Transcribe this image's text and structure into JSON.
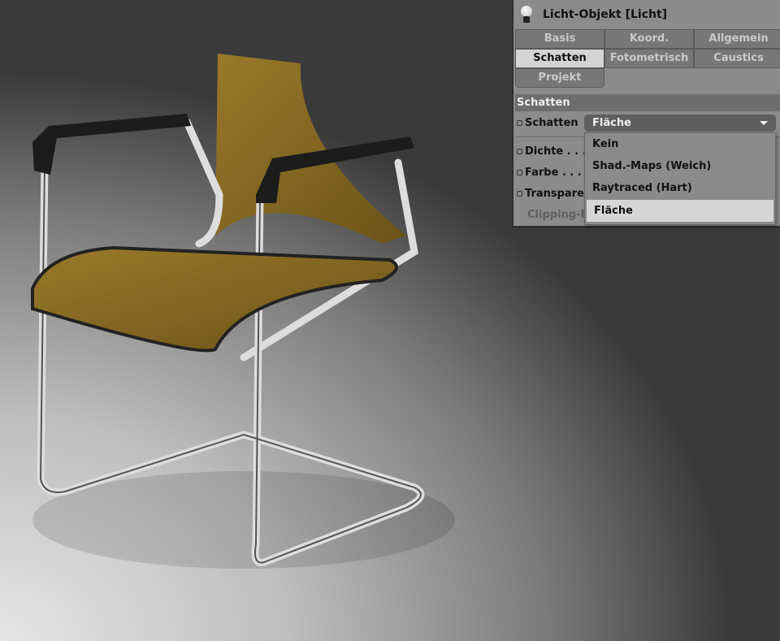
{
  "panel": {
    "title": "Licht-Objekt [Licht]",
    "tabs": [
      "Basis",
      "Koord.",
      "Allgemein",
      "Schatten",
      "Fotometrisch",
      "Caustics",
      "Projekt"
    ],
    "active_tab": "Schatten",
    "section": "Schatten",
    "fields": {
      "schatten": "Schatten",
      "dichte": "Dichte . . .",
      "farbe": "Farbe . . .",
      "transparenz": "Transparenz",
      "clipping": "Clipping-Einfluss"
    },
    "dropdown": {
      "value": "Fläche",
      "options": [
        "Kein",
        "Shad.-Maps (Weich)",
        "Raytraced (Hart)",
        "Fläche"
      ],
      "selected": "Fläche"
    }
  }
}
